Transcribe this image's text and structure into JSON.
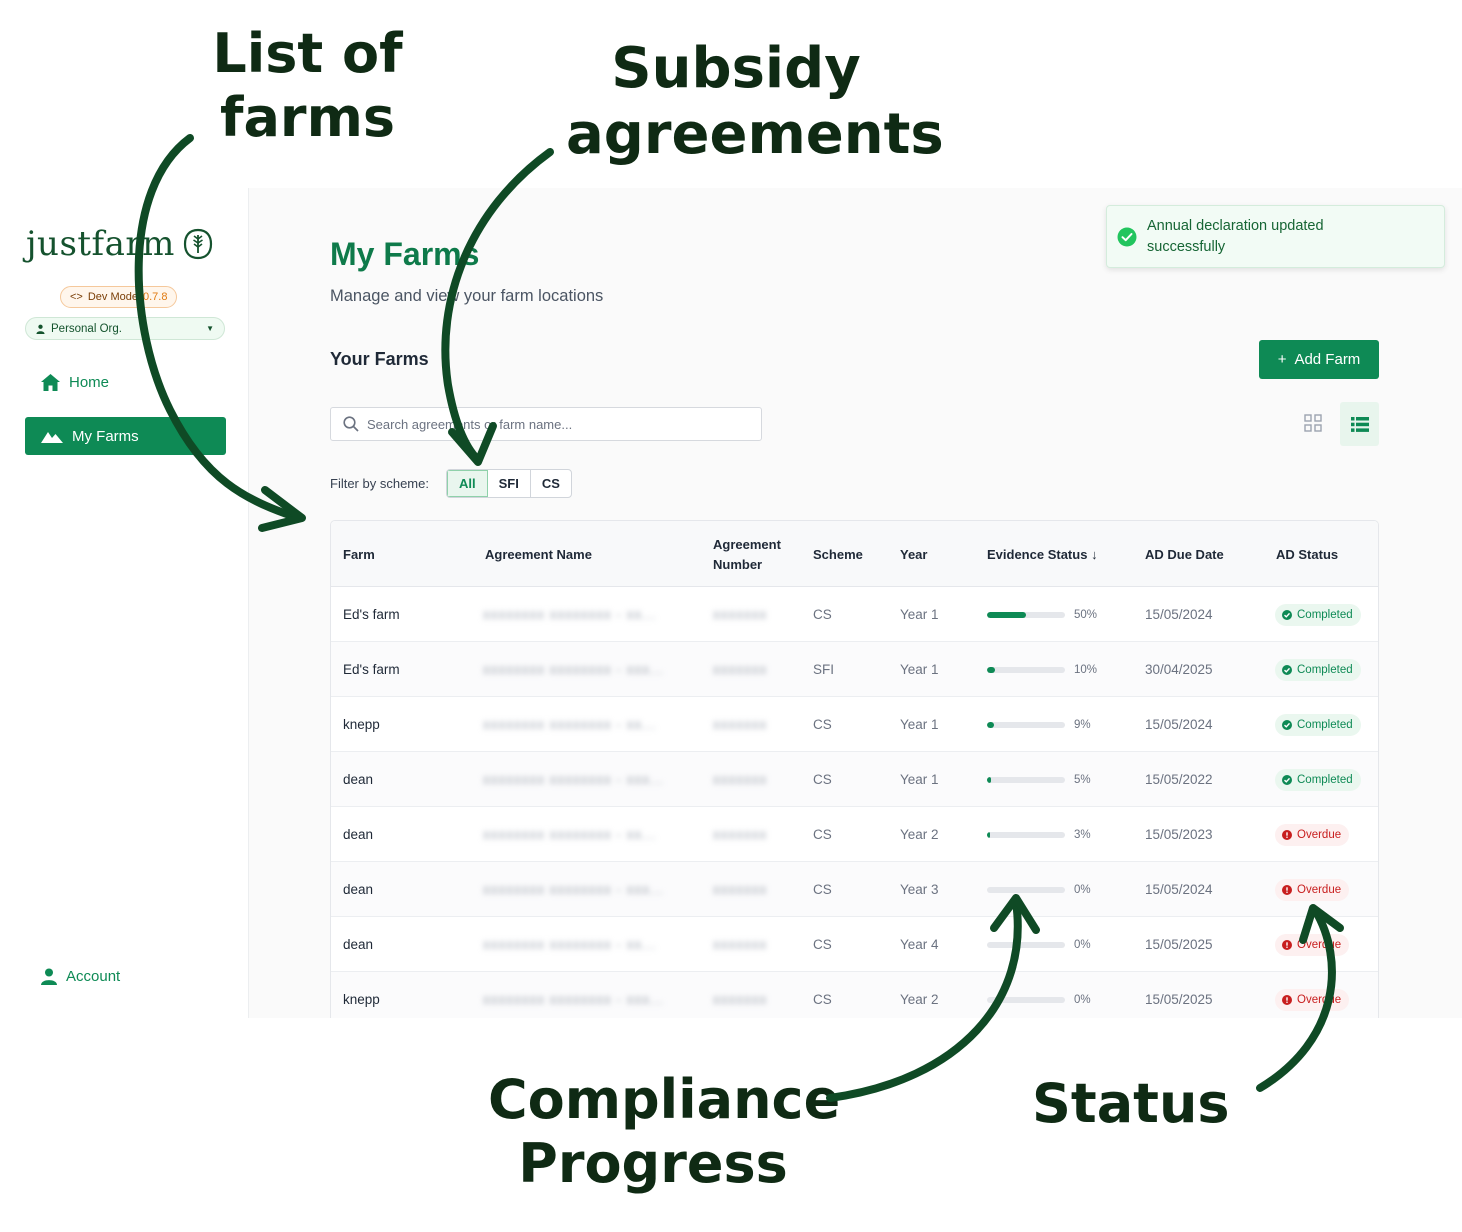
{
  "annotations": {
    "farms": "List of farms",
    "subsidy": "Subsidy agreements",
    "compliance": "Compliance Progress",
    "status": "Status"
  },
  "sidebar": {
    "logo": "justfarm",
    "dev_badge": "Dev Mode",
    "version": "0.7.8",
    "org": "Personal Org.",
    "nav_home": "Home",
    "nav_farms": "My Farms",
    "nav_account": "Account"
  },
  "main": {
    "title": "My Farms",
    "subtitle": "Manage and view your farm locations",
    "section_title": "Your Farms",
    "add_button": "Add Farm",
    "toast": "Annual declaration updated successfully",
    "search_placeholder": "Search agreements or farm name...",
    "filter_label": "Filter by scheme:",
    "filters": [
      "All",
      "SFI",
      "CS"
    ],
    "active_filter": "All"
  },
  "table": {
    "headers": [
      "Farm",
      "Agreement Name",
      "Agreement Number",
      "Scheme",
      "Year",
      "Evidence Status",
      "AD Due Date",
      "AD Status"
    ],
    "sort_indicator": "↓",
    "rows": [
      {
        "farm": "Ed's farm",
        "agreement_name": "xxxxxxxx xxxxxxxx - xx...",
        "agreement_number": "xxxxxxx",
        "scheme": "CS",
        "year": "Year 1",
        "progress": 50,
        "progress_label": "50%",
        "due": "15/05/2024",
        "status": "Completed"
      },
      {
        "farm": "Ed's farm",
        "agreement_name": "xxxxxxxx xxxxxxxx - xxx...",
        "agreement_number": "xxxxxxx",
        "scheme": "SFI",
        "year": "Year 1",
        "progress": 10,
        "progress_label": "10%",
        "due": "30/04/2025",
        "status": "Completed"
      },
      {
        "farm": "knepp",
        "agreement_name": "xxxxxxxx xxxxxxxx - xx...",
        "agreement_number": "xxxxxxx",
        "scheme": "CS",
        "year": "Year 1",
        "progress": 9,
        "progress_label": "9%",
        "due": "15/05/2024",
        "status": "Completed"
      },
      {
        "farm": "dean",
        "agreement_name": "xxxxxxxx xxxxxxxx - xxx...",
        "agreement_number": "xxxxxxx",
        "scheme": "CS",
        "year": "Year 1",
        "progress": 5,
        "progress_label": "5%",
        "due": "15/05/2022",
        "status": "Completed"
      },
      {
        "farm": "dean",
        "agreement_name": "xxxxxxxx xxxxxxxx - xx...",
        "agreement_number": "xxxxxxx",
        "scheme": "CS",
        "year": "Year 2",
        "progress": 3,
        "progress_label": "3%",
        "due": "15/05/2023",
        "status": "Overdue"
      },
      {
        "farm": "dean",
        "agreement_name": "xxxxxxxx xxxxxxxx - xxx...",
        "agreement_number": "xxxxxxx",
        "scheme": "CS",
        "year": "Year 3",
        "progress": 0,
        "progress_label": "0%",
        "due": "15/05/2024",
        "status": "Overdue"
      },
      {
        "farm": "dean",
        "agreement_name": "xxxxxxxx xxxxxxxx - xx...",
        "agreement_number": "xxxxxxx",
        "scheme": "CS",
        "year": "Year 4",
        "progress": 0,
        "progress_label": "0%",
        "due": "15/05/2025",
        "status": "Overdue"
      },
      {
        "farm": "knepp",
        "agreement_name": "xxxxxxxx xxxxxxxx - xxx...",
        "agreement_number": "xxxxxxx",
        "scheme": "CS",
        "year": "Year 2",
        "progress": 0,
        "progress_label": "0%",
        "due": "15/05/2025",
        "status": "Overdue"
      }
    ]
  },
  "colors": {
    "brand_green": "#0e8a55",
    "title_green": "#0e7a4a",
    "overdue_red": "#c81e1e",
    "annotation_ink": "#0f2a14"
  },
  "icons": [
    "wheat-logo-icon",
    "code-icon",
    "user-icon",
    "home-icon",
    "mountain-icon",
    "plus-icon",
    "check-circle-icon",
    "search-icon",
    "grid-view-icon",
    "list-view-icon",
    "alert-circle-icon",
    "sort-arrow-icon"
  ]
}
